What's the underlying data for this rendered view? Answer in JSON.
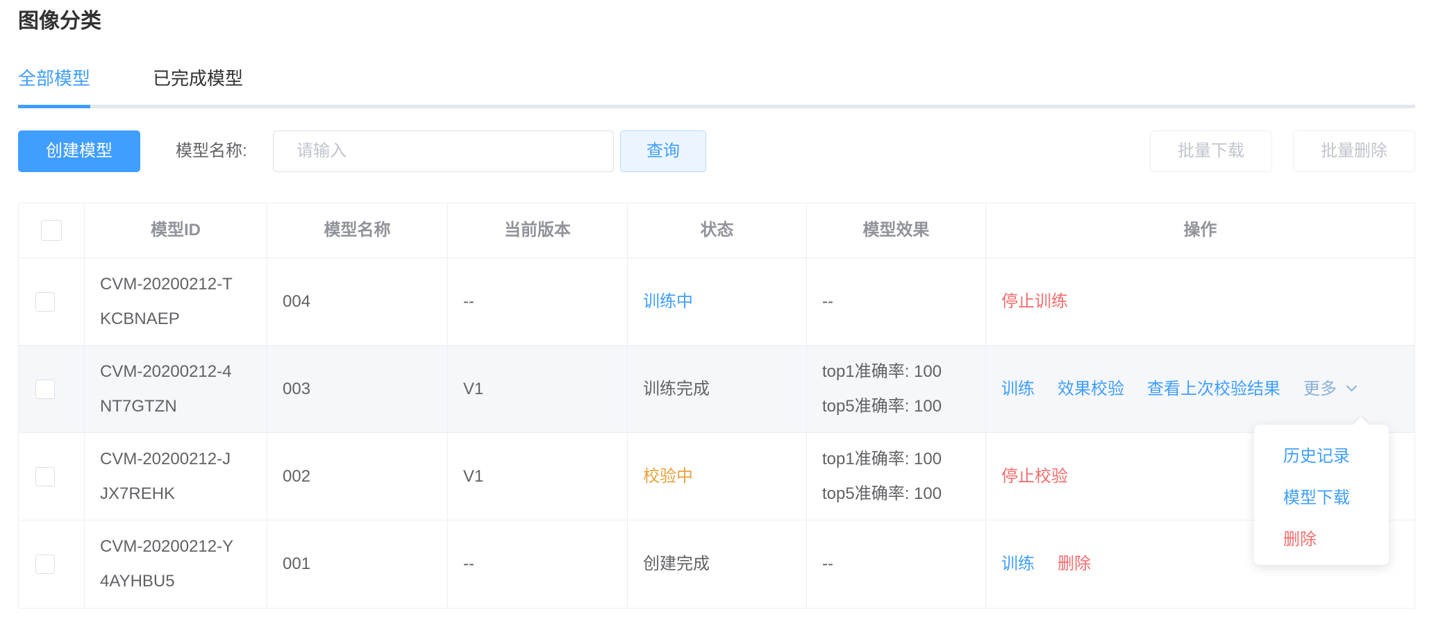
{
  "page": {
    "title": "图像分类"
  },
  "tabs": [
    {
      "label": "全部模型",
      "active": true
    },
    {
      "label": "已完成模型",
      "active": false
    }
  ],
  "toolbar": {
    "create_label": "创建模型",
    "search_label": "模型名称:",
    "search_placeholder": "请输入",
    "search_value": "",
    "query_label": "查询",
    "batch_download_label": "批量下载",
    "batch_delete_label": "批量删除"
  },
  "table": {
    "columns": [
      "模型ID",
      "模型名称",
      "当前版本",
      "状态",
      "模型效果",
      "操作"
    ],
    "rows": [
      {
        "id_line1": "CVM-20200212-T",
        "id_line2": "KCBNAEP",
        "name": "004",
        "version": "--",
        "status": "训练中",
        "effect": "--",
        "actions": [
          "停止训练"
        ]
      },
      {
        "id_line1": "CVM-20200212-4",
        "id_line2": "NT7GTZN",
        "name": "003",
        "version": "V1",
        "status": "训练完成",
        "effect_line1": "top1准确率: 100",
        "effect_line2": "top5准确率: 100",
        "actions": [
          "训练",
          "效果校验",
          "查看上次校验结果",
          "更多"
        ]
      },
      {
        "id_line1": "CVM-20200212-J",
        "id_line2": "JX7REHK",
        "name": "002",
        "version": "V1",
        "status": "校验中",
        "effect_line1": "top1准确率: 100",
        "effect_line2": "top5准确率: 100",
        "actions": [
          "停止校验"
        ]
      },
      {
        "id_line1": "CVM-20200212-Y",
        "id_line2": "4AYHBU5",
        "name": "001",
        "version": "--",
        "status": "创建完成",
        "effect": "--",
        "actions": [
          "训练",
          "删除"
        ]
      }
    ]
  },
  "more_menu": {
    "items": [
      "历史记录",
      "模型下载",
      "删除"
    ]
  },
  "colors": {
    "primary": "#409eff",
    "danger": "#f56c6c",
    "warning": "#e6a23c"
  }
}
